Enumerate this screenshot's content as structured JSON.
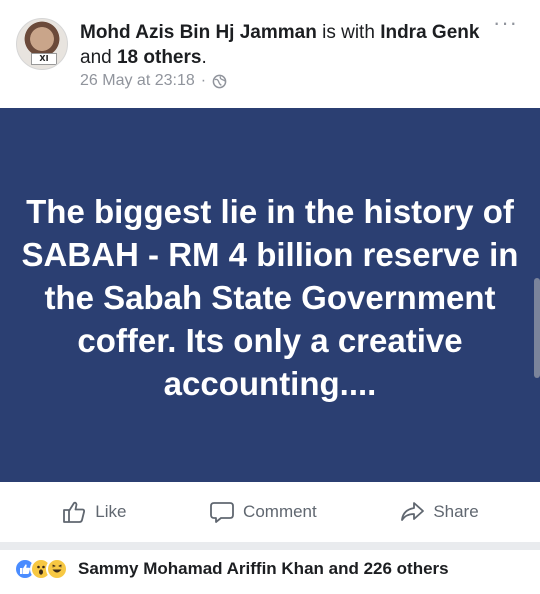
{
  "post": {
    "author": "Mohd Azis Bin Hj Jamman",
    "with_text": " is with ",
    "tagged": "Indra Genk",
    "and_text": " and ",
    "others": "18 others",
    "period": ".",
    "timestamp": "26 May at 23:18",
    "separator": "·",
    "avatar_badge": "XI",
    "body_text": "The biggest lie in the history of SABAH - RM 4 billion reserve in the Sabah State Government coffer.  Its only a creative accounting...."
  },
  "actions": {
    "like_label": "Like",
    "comment_label": "Comment",
    "share_label": "Share"
  },
  "reactions": {
    "summary": "Sammy Mohamad Ariffin Khan and 226 others",
    "icons": [
      "like-icon",
      "wow-icon",
      "haha-icon"
    ]
  },
  "colors": {
    "card_background": "#2b3f72",
    "secondary_text": "#90949c",
    "like_blue": "#4a8cff",
    "emoji_yellow": "#f7c843"
  }
}
